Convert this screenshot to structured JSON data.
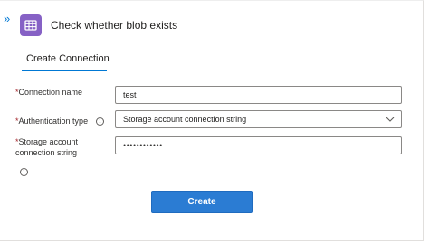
{
  "header": {
    "collapse_glyph": "»",
    "title": "Check whether blob exists",
    "app_icon": "storage-blob-icon"
  },
  "tabs": [
    {
      "label": "Create Connection",
      "selected": true
    }
  ],
  "form": {
    "required_marker": "*",
    "connection_name": {
      "label": "Connection name",
      "value": "test"
    },
    "authentication_type": {
      "label": "Authentication type",
      "value": "Storage account connection string"
    },
    "storage_connection_string": {
      "label_line1": "Storage account",
      "label_line2": "connection string",
      "masked_value": "••••••••••••"
    }
  },
  "create_button": {
    "label": "Create"
  },
  "colors": {
    "accent": "#0078d4",
    "button": "#2b7cd3",
    "required": "#a4262c",
    "app_icon_bg": "#8661c5"
  }
}
